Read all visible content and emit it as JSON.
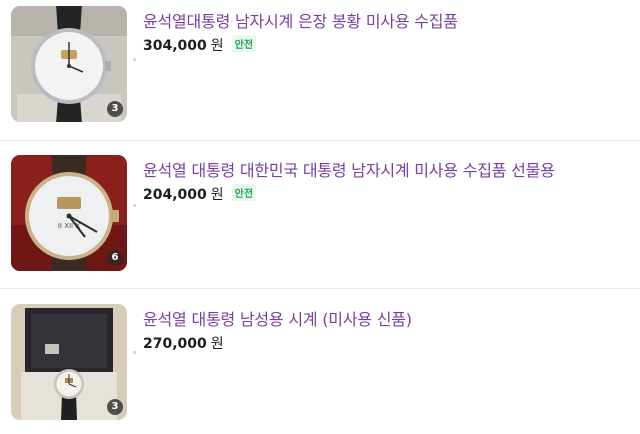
{
  "listings": [
    {
      "title": "윤석열대통령 남자시계 은장 봉황 미사용 수집품",
      "price": "304,000",
      "currency": "원",
      "safe_badge": "안전",
      "image_count": "3",
      "thumb_icon": "wristwatch-black-strap-photo"
    },
    {
      "title": "윤석열 대통령 대한민국 대통령 남자시계 미사용 수집품 선물용",
      "price": "204,000",
      "currency": "원",
      "safe_badge": "안전",
      "image_count": "6",
      "thumb_icon": "wristwatch-closeup-photo"
    },
    {
      "title": "윤석열 대통령 남성용 시계 (미사용 신품)",
      "price": "270,000",
      "currency": "원",
      "image_count": "3",
      "thumb_icon": "wristwatch-in-gift-box-photo"
    }
  ],
  "colors": {
    "title": "#7b3fa0",
    "price": "#1e1e1e",
    "safe_badge_text": "#23a05a",
    "safe_badge_bg": "#e9f7ee"
  }
}
